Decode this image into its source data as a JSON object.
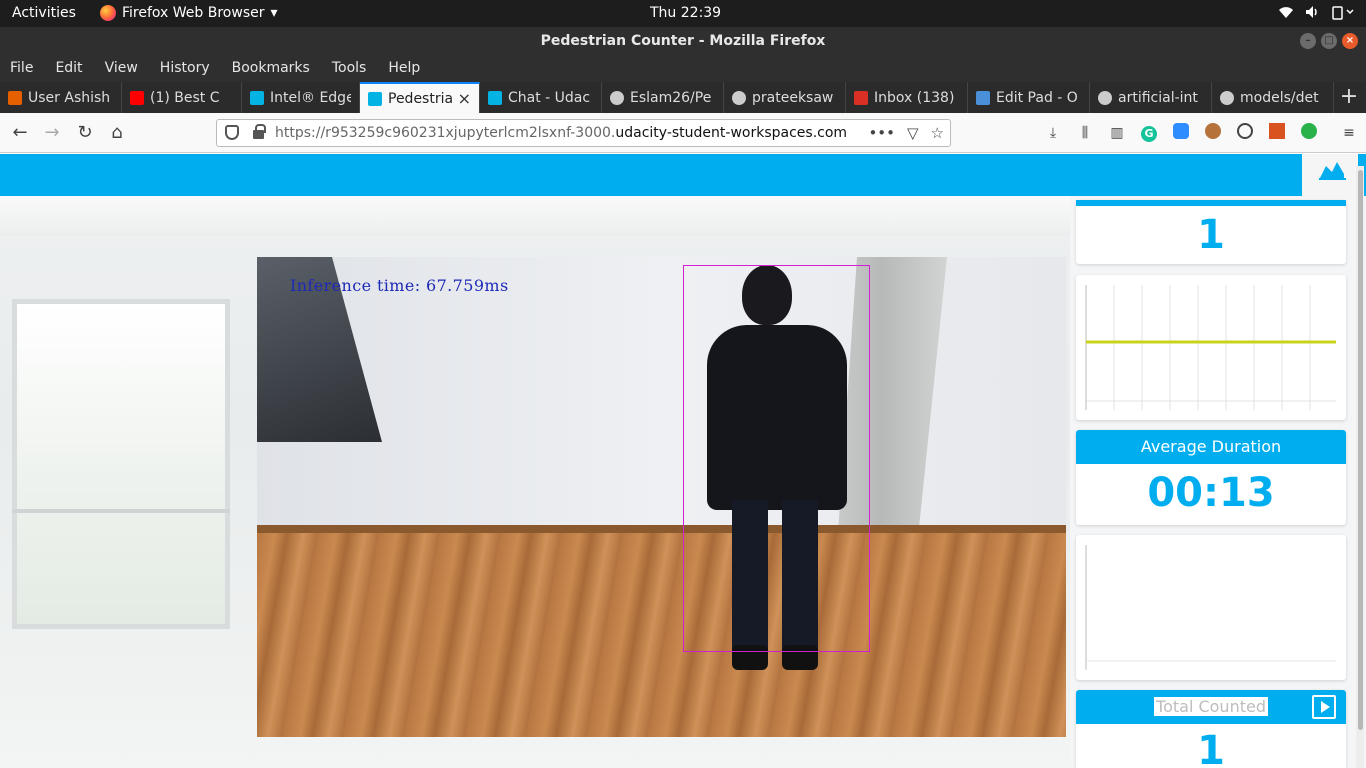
{
  "system": {
    "activities": "Activities",
    "app_menu": "Firefox Web Browser",
    "app_menu_caret": "▾",
    "clock": "Thu 22:39",
    "tray": [
      "wifi-icon",
      "volume-icon",
      "power-icon"
    ]
  },
  "window": {
    "title": "Pedestrian Counter - Mozilla Firefox"
  },
  "menu": [
    "File",
    "Edit",
    "View",
    "History",
    "Bookmarks",
    "Tools",
    "Help"
  ],
  "tabs": [
    {
      "label": "User Ashish",
      "icon": "udacity-user-icon",
      "color": "#e66000"
    },
    {
      "label": "(1) Best C",
      "icon": "youtube-icon",
      "color": "#ff0000"
    },
    {
      "label": "Intel® Edge",
      "icon": "udacity-icon",
      "color": "#02b3e4"
    },
    {
      "label": "Pedestria",
      "icon": "udacity-icon",
      "color": "#02b3e4",
      "active": true
    },
    {
      "label": "Chat - Udac",
      "icon": "udacity-icon",
      "color": "#02b3e4"
    },
    {
      "label": "Eslam26/Pe",
      "icon": "github-icon",
      "color": "#cccccc"
    },
    {
      "label": "prateeksaw",
      "icon": "github-icon",
      "color": "#cccccc"
    },
    {
      "label": "Inbox (138)",
      "icon": "gmail-icon",
      "color": "#d93025"
    },
    {
      "label": "Edit Pad - O",
      "icon": "editpad-icon",
      "color": "#4a90d9"
    },
    {
      "label": "artificial-int",
      "icon": "github-icon",
      "color": "#cccccc"
    },
    {
      "label": "models/det",
      "icon": "github-icon",
      "color": "#cccccc"
    }
  ],
  "url": {
    "prefix": "https://r953259c960231xjupyterlcm2lsxnf-3000.",
    "domain": "udacity-student-workspaces.com"
  },
  "video": {
    "inference_text": "Inference time: 67.759ms"
  },
  "stats": {
    "current_count": "1",
    "avg_duration_label": "Average Duration",
    "avg_duration": "00:13",
    "total_label": "Total Counted",
    "total_count": "1"
  },
  "colors": {
    "accent": "#00aeef",
    "chart_line": "#c8d31a",
    "bbox": "#d21fd2"
  }
}
